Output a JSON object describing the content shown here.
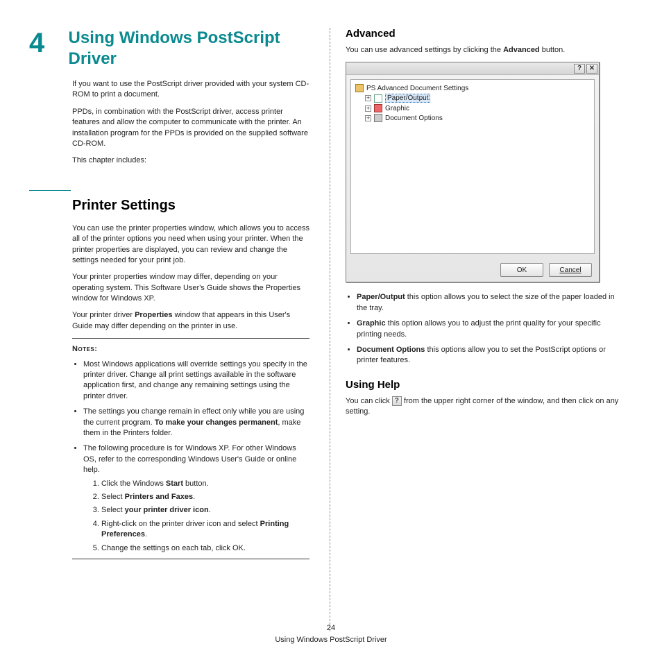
{
  "chapter": {
    "num": "4",
    "title": "Using Windows PostScript Driver"
  },
  "intro": {
    "p1": "If you want to use the PostScript driver provided with your system CD-ROM to print a document.",
    "p2": "PPDs, in combination with the PostScript driver, access printer features and allow the computer to communicate with the printer. An installation program for the PPDs is provided on the supplied software CD-ROM.",
    "p3": "This chapter includes:"
  },
  "printer": {
    "heading": "Printer Settings",
    "p1": "You can use the printer properties window, which allows you to access all of the printer options you need when using your printer. When the printer properties are displayed, you can review and change the settings needed for your print job.",
    "p2": "Your printer properties window may differ, depending on your operating system. This Software User's Guide shows the Properties window for Windows XP.",
    "p3_a": "Your printer driver ",
    "p3_b": "Properties",
    "p3_c": " window that appears in this User's Guide may differ depending on the printer in use.",
    "notes_label": "Notes",
    "n1": "Most Windows applications will override settings you specify in the printer driver. Change all print settings available in the software application first, and change any remaining settings using the printer driver.",
    "n2_a": "The settings you change remain in effect only while you are using the current program. ",
    "n2_b": "To make your changes permanent",
    "n2_c": ", make them in the Printers folder.",
    "n3": "The following procedure is for Windows XP. For other Windows OS, refer to the corresponding Windows User's Guide or online help.",
    "s1_a": "Click the Windows ",
    "s1_b": "Start",
    "s1_c": " button.",
    "s2_a": "Select ",
    "s2_b": "Printers and Faxes",
    "s2_c": ".",
    "s3_a": "Select ",
    "s3_b": "your printer driver icon",
    "s3_c": ".",
    "s4_a": "Right-click on the printer driver icon and select ",
    "s4_b": "Printing Preferences",
    "s4_c": ".",
    "s5": "Change the settings on each tab, click OK."
  },
  "advanced": {
    "heading": "Advanced",
    "p1_a": "You can use advanced settings by clicking the ",
    "p1_b": "Advanced",
    "p1_c": " button.",
    "dlg": {
      "root": "PS Advanced Document Settings",
      "paper": "Paper/Output",
      "graphic": "Graphic",
      "docopt": "Document Options",
      "ok": "OK",
      "cancel": "Cancel",
      "help": "?",
      "close": "✕"
    },
    "b1_a": "Paper/Output",
    "b1_b": " this option allows you to select the size of the paper loaded in the tray.",
    "b2_a": "Graphic",
    "b2_b": " this option allows you to adjust the print quality for your specific printing needs.",
    "b3_a": "Document Options",
    "b3_b": " this options allow you to set the PostScript options or printer features."
  },
  "help": {
    "heading": "Using Help",
    "p_a": "You can click ",
    "p_b": " from the upper right corner of the window, and then click on any setting."
  },
  "footer": {
    "page": "24",
    "title": "Using Windows PostScript Driver"
  }
}
